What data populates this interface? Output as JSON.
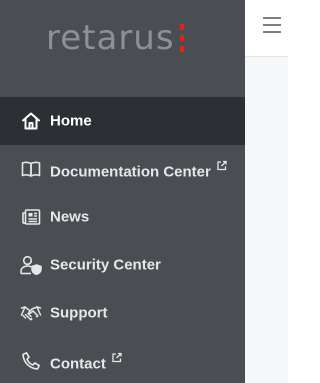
{
  "brand": {
    "logo_text": "retarus",
    "accent_color": "#e2231a"
  },
  "sidebar": {
    "items": [
      {
        "label": "Home",
        "icon": "home-icon",
        "active": true,
        "external": false
      },
      {
        "label": "Documentation Center",
        "icon": "book-icon",
        "active": false,
        "external": true
      },
      {
        "label": "News",
        "icon": "newspaper-icon",
        "active": false,
        "external": false
      },
      {
        "label": "Security Center",
        "icon": "user-shield-icon",
        "active": false,
        "external": false
      },
      {
        "label": "Support",
        "icon": "handshake-icon",
        "active": false,
        "external": false
      },
      {
        "label": "Contact",
        "icon": "phone-icon",
        "active": false,
        "external": true
      }
    ]
  },
  "header": {
    "menu_icon": "hamburger-menu-icon"
  },
  "colors": {
    "sidebar_bg": "#4a4d52",
    "active_bg": "#2c2f33",
    "text": "#e6e7e8"
  }
}
